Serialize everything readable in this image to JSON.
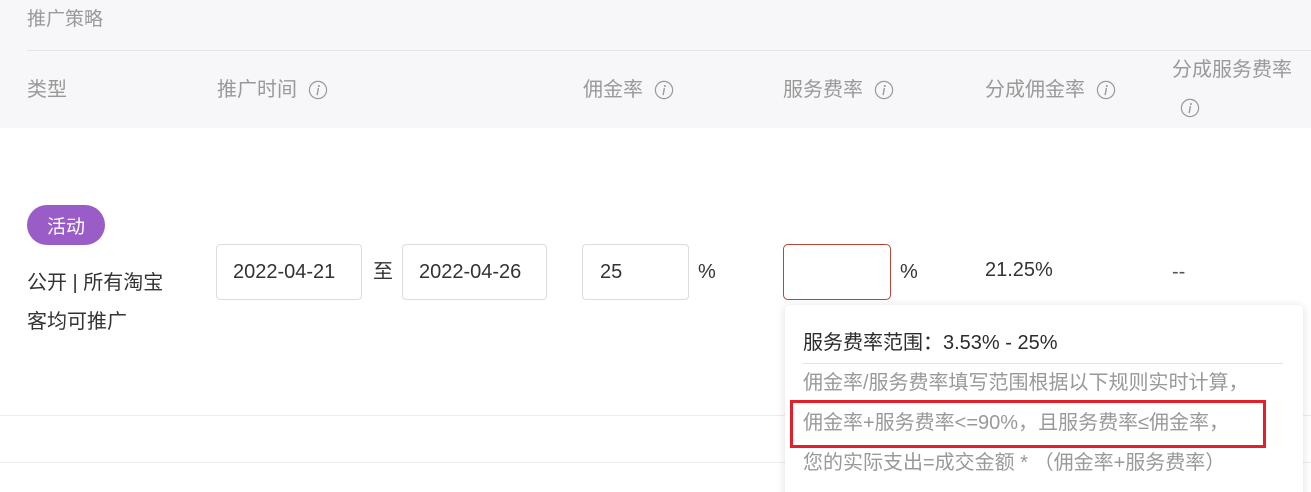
{
  "section_title": "推广策略",
  "columns": [
    {
      "label": "类型"
    },
    {
      "label": "推广时间",
      "icon": "info-icon"
    },
    {
      "label": "佣金率",
      "icon": "info-icon"
    },
    {
      "label": "服务费率",
      "icon": "info-icon"
    },
    {
      "label": "分成佣金率",
      "icon": "info-icon"
    },
    {
      "label": "分成服务费率",
      "icon": "info-icon"
    }
  ],
  "row": {
    "type_badge": "活动",
    "type_description": [
      "公开 | 所有淘宝",
      "客均可推广"
    ],
    "start_date": "2022-04-21",
    "date_separator": "至",
    "end_date": "2022-04-26",
    "commission_rate": "25",
    "commission_unit": "%",
    "service_rate": "",
    "service_unit": "%",
    "split_commission_rate": "21.25%",
    "split_service_rate": "--"
  },
  "tooltip": {
    "title": "服务费率范围：3.53% - 25%",
    "lines": [
      "佣金率/服务费率填写范围根据以下规则实时计算，",
      "佣金率+服务费率<=90%，且服务费率≤佣金率，",
      "您的实际支出=成交金额 * （佣金率+服务费率）"
    ]
  },
  "colors": {
    "header_bg": "#f7f7f9",
    "badge_purple": "#9a5cc6",
    "error_border": "#b5463a",
    "annotation_red": "#e3202a",
    "muted_text": "#999999",
    "body_text": "#333333"
  }
}
